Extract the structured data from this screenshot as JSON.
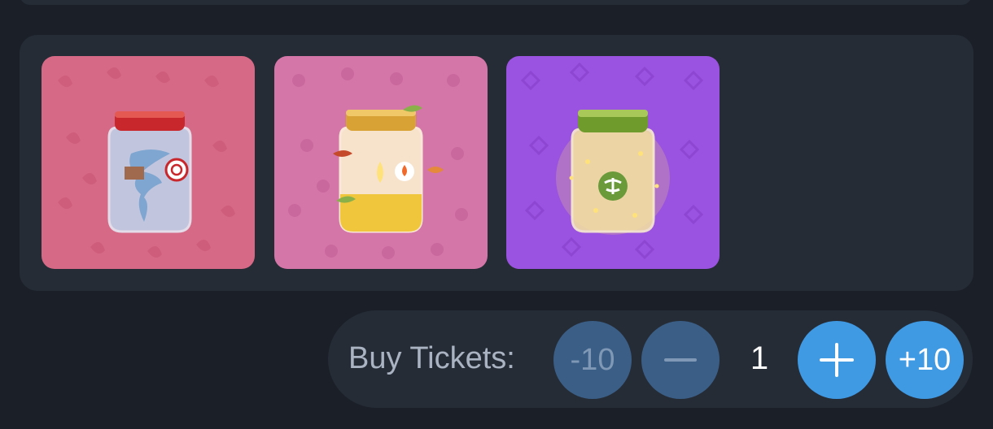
{
  "items": [
    {
      "name": "tornado-jar",
      "icon": "tornado-jar-icon",
      "bg": "#d66a86",
      "lid": "#c8282c"
    },
    {
      "name": "candle-jar",
      "icon": "candle-jar-icon",
      "bg": "#d476a8",
      "lid": "#d9a234"
    },
    {
      "name": "firefly-jar",
      "icon": "firefly-jar-icon",
      "bg": "#9a52e0",
      "lid": "#6f9a2c"
    }
  ],
  "tickets": {
    "label": "Buy Tickets:",
    "minus_ten_label": "-10",
    "quantity": "1",
    "plus_ten_label": "+10"
  },
  "colors": {
    "background": "#1b2028",
    "panel": "#262c36",
    "button_dim": "#3a5e86",
    "button_bright": "#3f99e3"
  }
}
